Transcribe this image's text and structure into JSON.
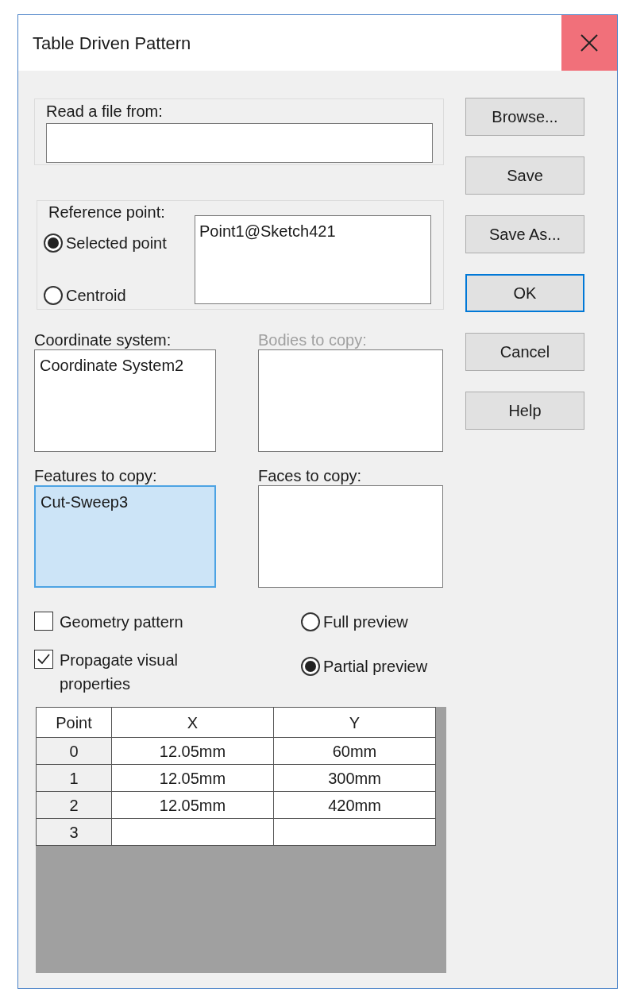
{
  "window": {
    "title": "Table Driven Pattern"
  },
  "read_file": {
    "label": "Read a file from:"
  },
  "reference_point": {
    "label": "Reference point:",
    "options": [
      {
        "label": "Selected point",
        "selected": true
      },
      {
        "label": "Centroid",
        "selected": false
      }
    ],
    "value": "Point1@Sketch421"
  },
  "lists": [
    {
      "label": "Coordinate system:",
      "items": [
        "Coordinate System2"
      ],
      "disabled": false,
      "selected": false
    },
    {
      "label": "Bodies to copy:",
      "disabled": true,
      "selected": false
    },
    {
      "label": "Features to copy:",
      "items": [
        "Cut-Sweep3"
      ],
      "disabled": false,
      "selected": true
    },
    {
      "label": "Faces to copy:",
      "disabled": false,
      "selected": false
    }
  ],
  "checkboxes": [
    {
      "label": "Geometry pattern",
      "checked": false
    },
    {
      "label": "Propagate visual properties",
      "checked": true
    }
  ],
  "preview": [
    {
      "label": "Full preview",
      "selected": false
    },
    {
      "label": "Partial preview",
      "selected": true
    }
  ],
  "table": {
    "columns": [
      "Point",
      "X",
      "Y"
    ],
    "rows": [
      [
        "0",
        "12.05mm",
        "60mm"
      ],
      [
        "1",
        "12.05mm",
        "300mm"
      ],
      [
        "2",
        "12.05mm",
        "420mm"
      ],
      [
        "3"
      ]
    ]
  },
  "buttons": [
    {
      "label": "Browse...",
      "default": false
    },
    {
      "label": "Save",
      "default": false
    },
    {
      "label": "Save As...",
      "default": false
    },
    {
      "label": "OK",
      "default": true
    },
    {
      "label": "Cancel",
      "default": false
    },
    {
      "label": "Help",
      "default": false
    }
  ]
}
